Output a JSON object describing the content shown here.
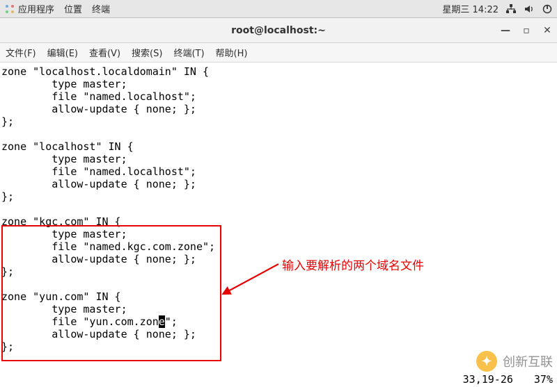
{
  "panel": {
    "menus": [
      "应用程序",
      "位置",
      "终端"
    ],
    "clock": "星期三 14:22"
  },
  "window": {
    "title": "root@localhost:~"
  },
  "menubar": {
    "items": [
      "文件(F)",
      "编辑(E)",
      "查看(V)",
      "搜索(S)",
      "终端(T)",
      "帮助(H)"
    ]
  },
  "terminal_lines": [
    "zone \"localhost.localdomain\" IN {",
    "        type master;",
    "        file \"named.localhost\";",
    "        allow-update { none; };",
    "};",
    "",
    "zone \"localhost\" IN {",
    "        type master;",
    "        file \"named.localhost\";",
    "        allow-update { none; };",
    "};",
    "",
    "zone \"kgc.com\" IN {",
    "        type master;",
    "        file \"named.kgc.com.zone\";",
    "        allow-update { none; };",
    "};",
    "",
    "zone \"yun.com\" IN {",
    "        type master;",
    "        file \"yun.com.zon",
    "        allow-update { none; };",
    "};"
  ],
  "cursor_line_suffix": "e\";",
  "cursor_char": "e",
  "annotation_text": "输入要解析的两个域名文件",
  "status": {
    "pos": "33,19-26",
    "pct": "37%"
  },
  "watermark_text": "创新互联"
}
